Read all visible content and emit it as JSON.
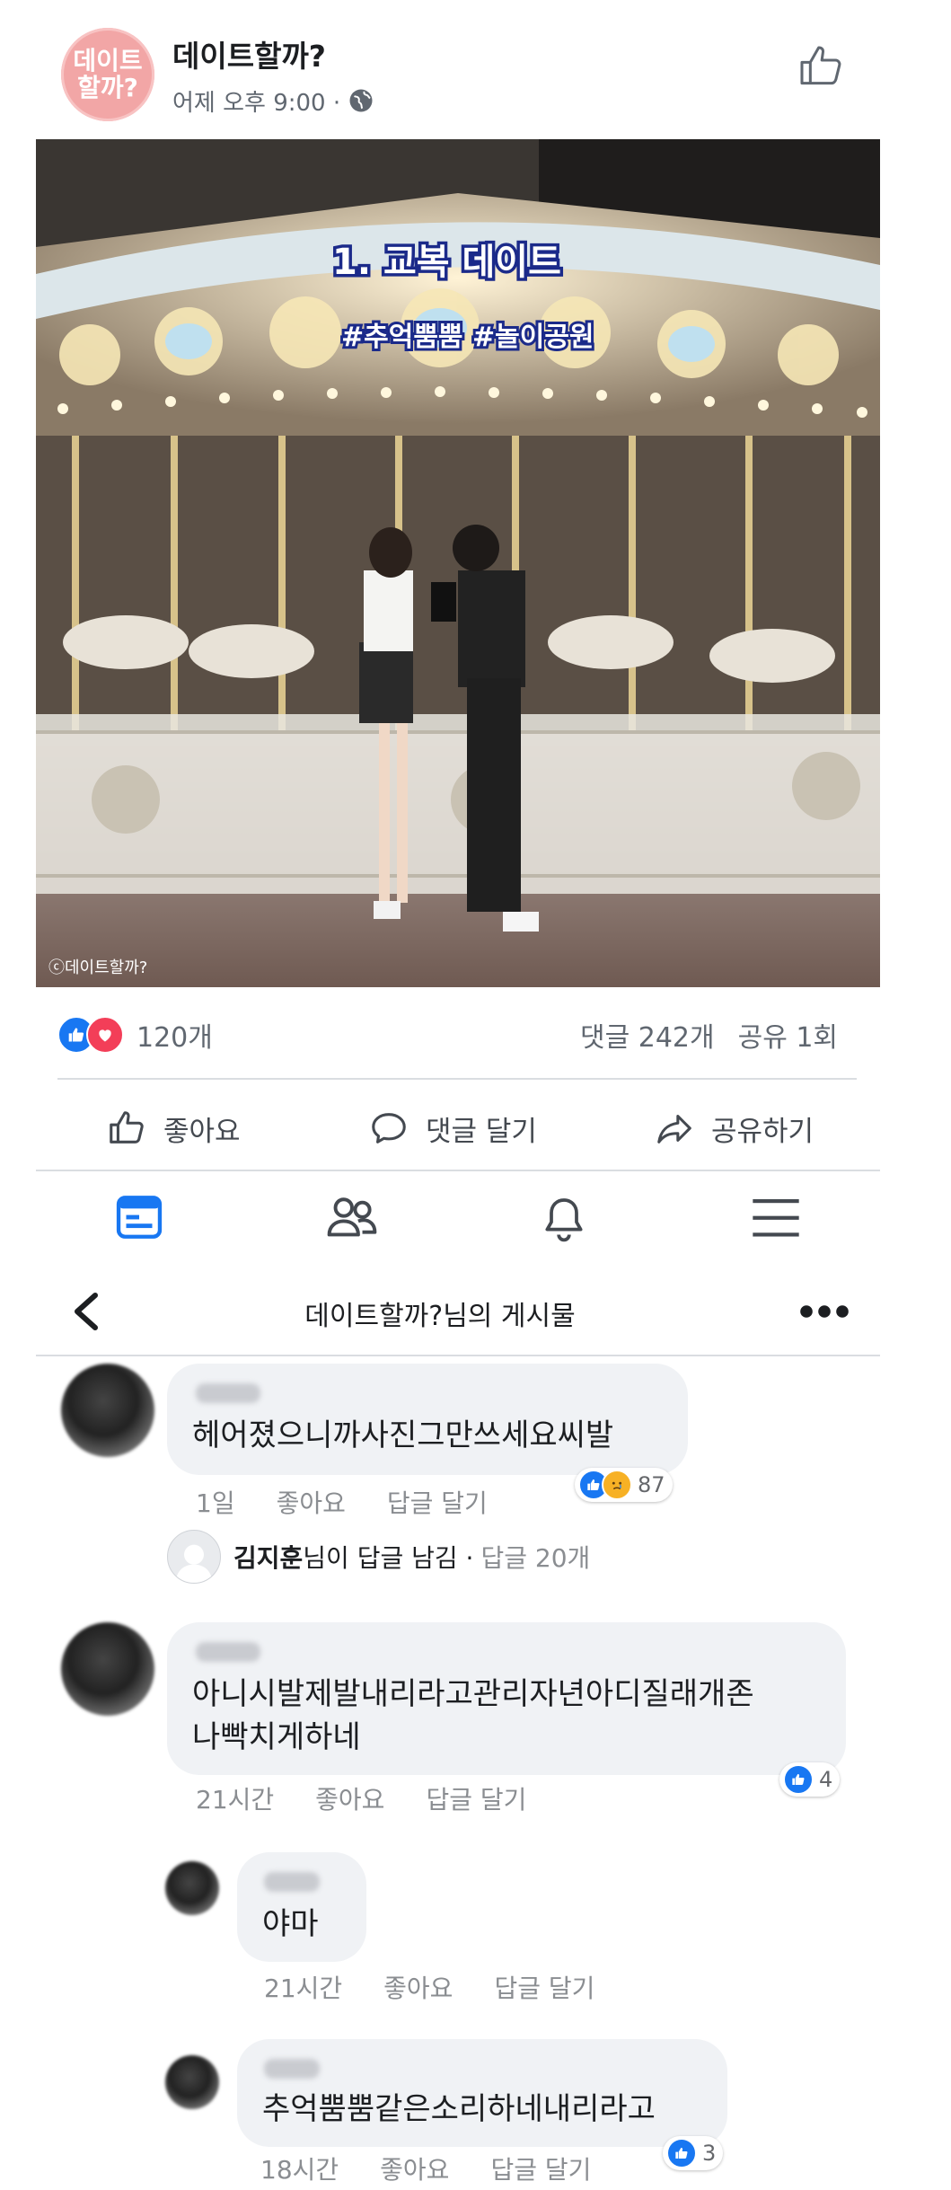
{
  "post": {
    "page_name": "데이트할까?",
    "avatar_text_line1": "데이트",
    "avatar_text_line2": "할까?",
    "time": "어제 오후 9:00 ·",
    "image": {
      "title": "1. 교복 데이트",
      "hashtags": "#추억뿜뿜 #놀이공원",
      "watermark": "ⓒ데이트할까?"
    },
    "reaction_count": "120개",
    "comment_count": "댓글 242개",
    "share_count": "공유 1회",
    "actions": {
      "like": "좋아요",
      "comment": "댓글 달기",
      "share": "공유하기"
    }
  },
  "bottom_nav": {
    "items": [
      "feed-icon",
      "friends-icon",
      "bell-icon",
      "menu-icon"
    ]
  },
  "thread_header": {
    "title": "데이트할까?님의 게시물"
  },
  "comments": [
    {
      "text": "헤어졌으니까사진그만쓰세요씨발",
      "age": "1일",
      "like": "좋아요",
      "reply": "답글 달기",
      "reactions": "87"
    },
    {
      "text": "아니시발제발내리라고관리자년아디질래개존나빡치게하네",
      "text_line1": "아니시발제발내리라고관리자년아디질래개존",
      "text_line2": "나빡치게하네",
      "age": "21시간",
      "like": "좋아요",
      "reply": "답글 달기",
      "reactions": "4"
    },
    {
      "text": "야마",
      "age": "21시간",
      "like": "좋아요",
      "reply": "답글 달기"
    },
    {
      "text": "추억뿜뿜같은소리하네내리라고",
      "age": "18시간",
      "like": "좋아요",
      "reply": "답글 달기",
      "reactions": "3"
    }
  ],
  "reply_summary": {
    "name": "김지훈",
    "suffix": "님이 답글 남김 ·",
    "count": "답글 20개"
  },
  "colors": {
    "facebook_blue": "#1877f2",
    "love_red": "#f33e58",
    "bubble": "#f0f2f5"
  }
}
